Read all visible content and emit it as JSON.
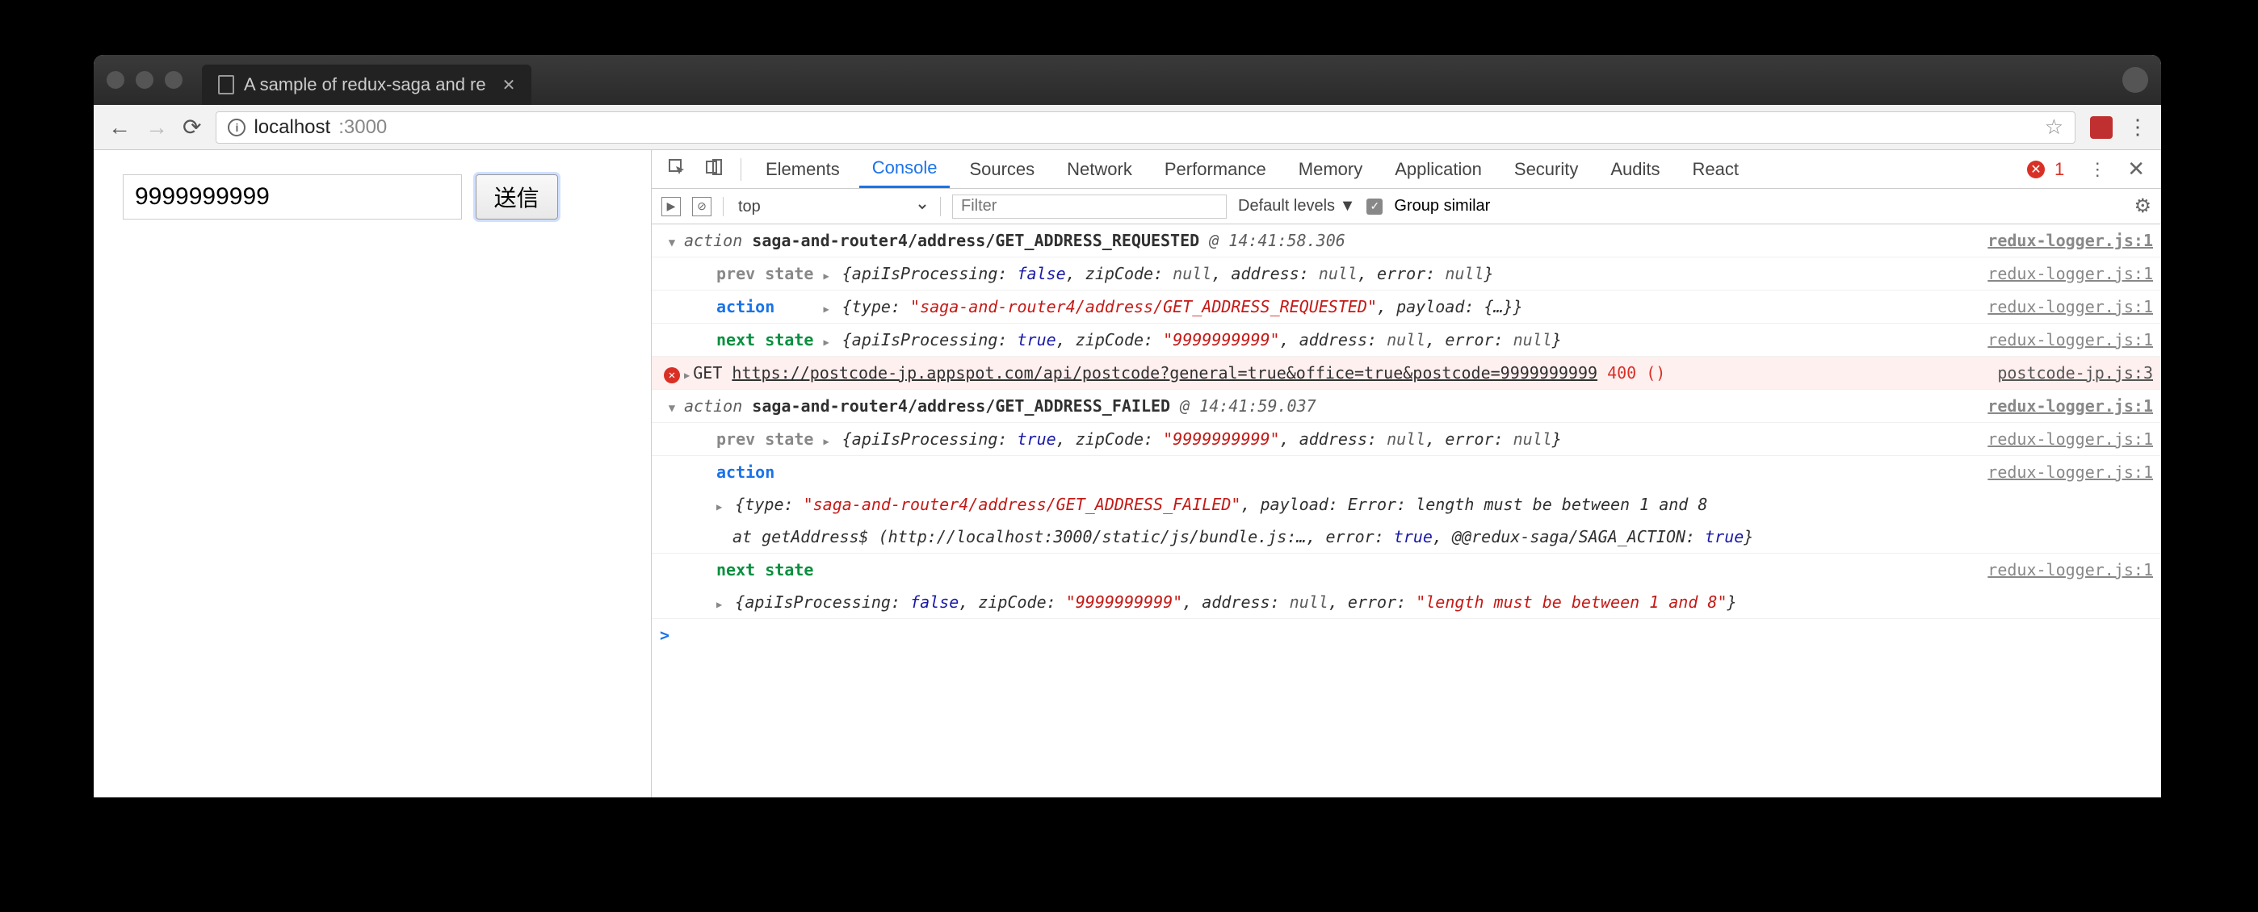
{
  "browser": {
    "tab_title": "A sample of redux-saga and re",
    "url_host": "localhost",
    "url_port": ":3000"
  },
  "page": {
    "zip_value": "9999999999",
    "submit_label": "送信"
  },
  "devtools": {
    "tabs": [
      "Elements",
      "Console",
      "Sources",
      "Network",
      "Performance",
      "Memory",
      "Application",
      "Security",
      "Audits",
      "React"
    ],
    "active_tab": "Console",
    "error_count": "1",
    "context": "top",
    "filter_placeholder": "Filter",
    "levels_label": "Default levels ▼",
    "group_label": "Group similar"
  },
  "log": {
    "a1_prefix": "action ",
    "a1_name": "saga-and-router4/address/GET_ADDRESS_REQUESTED",
    "a1_time": " @ 14:41:58.306",
    "src_logger": "redux-logger.js:1",
    "prev_label": "prev state ",
    "action_label": "action",
    "next_label": "next state ",
    "prev1": {
      "open": "{apiIsProcessing: ",
      "v1": "false",
      "mid1": ", zipCode: ",
      "v2": "null",
      "mid2": ", address: ",
      "v3": "null",
      "mid3": ", error: ",
      "v4": "null",
      "close": "}"
    },
    "act1": {
      "open": "{type: ",
      "v1": "\"saga-and-router4/address/GET_ADDRESS_REQUESTED\"",
      "mid1": ", payload: ",
      "v2": "{…}",
      "close": "}"
    },
    "next1": {
      "open": "{apiIsProcessing: ",
      "v1": "true",
      "mid1": ", zipCode: ",
      "v2": "\"9999999999\"",
      "mid2": ", address: ",
      "v3": "null",
      "mid3": ", error: ",
      "v4": "null",
      "close": "}"
    },
    "err": {
      "method": "GET ",
      "url": "https://postcode-jp.appspot.com/api/postcode?general=true&office=true&postcode=9999999999",
      "status": " 400 ()",
      "src": "postcode-jp.js:3"
    },
    "a2_prefix": "action ",
    "a2_name": "saga-and-router4/address/GET_ADDRESS_FAILED",
    "a2_time": " @ 14:41:59.037",
    "prev2": {
      "open": "{apiIsProcessing: ",
      "v1": "true",
      "mid1": ", zipCode: ",
      "v2": "\"9999999999\"",
      "mid2": ", address: ",
      "v3": "null",
      "mid3": ", error: ",
      "v4": "null",
      "close": "}"
    },
    "act2_line1": {
      "open": "{type: ",
      "v1": "\"saga-and-router4/address/GET_ADDRESS_FAILED\"",
      "mid1": ", payload: Error: length must be between 1 and 8"
    },
    "act2_line2": {
      "text": "    at getAddress$ (http://localhost:3000/static/js/bundle.js:…, error: ",
      "v1": "true",
      "mid1": ", @@redux-saga/SAGA_ACTION: ",
      "v2": "true",
      "close": "}"
    },
    "next2": {
      "open": "{apiIsProcessing: ",
      "v1": "false",
      "mid1": ", zipCode: ",
      "v2": "\"9999999999\"",
      "mid2": ", address: ",
      "v3": "null",
      "mid3": ", error: ",
      "v4": "\"length must be between 1 and 8\"",
      "close": "}"
    },
    "prompt": ">"
  }
}
